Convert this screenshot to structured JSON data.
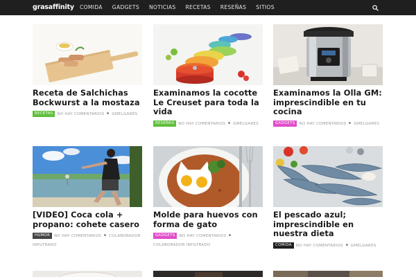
{
  "header": {
    "logo": "grasaffinity",
    "nav": [
      "COMIDA",
      "GADGETS",
      "NOTICIAS",
      "RECETAS",
      "RESEÑAS",
      "SITIOS"
    ]
  },
  "colors": {
    "topbar": "#1f1f1f",
    "recetas": "#5fbf3c",
    "resenas": "#5fbf3c",
    "gadgets": "#e14ecb",
    "humor": "#444444",
    "comida": "#1f1f1f"
  },
  "posts": [
    {
      "title": "Receta de Salchichas Bockwurst a la mostaza",
      "category": "RECETAS",
      "comments": "NO HAY COMENTARIOS",
      "author": "GMELGARES",
      "image": "sausages-mustard"
    },
    {
      "title": "Examinamos la cocotte Le Creuset para toda la vida",
      "category": "RESEÑAS",
      "comments": "NO HAY COMENTARIOS",
      "author": "GMELGARES",
      "image": "colorful-cocottes"
    },
    {
      "title": "Examinamos la Olla GM: imprescindible en tu cocina",
      "category": "GADGETS",
      "comments": "NO HAY COMENTARIOS",
      "author": "GMELGARES",
      "image": "pressure-cooker"
    },
    {
      "title": "[VIDEO] Coca cola + propano: cohete casero",
      "category": "HUMOR",
      "comments": "NO HAY COMENTARIOS",
      "author": "COLABORADOR INFILTRADO",
      "image": "lake-rocket"
    },
    {
      "title": "Molde para huevos con forma de gato",
      "category": "GADGETS",
      "comments": "NO HAY COMENTARIOS",
      "author": "COLABORADOR INFILTRADO",
      "image": "cat-eggs"
    },
    {
      "title": "El pescado azul; imprescindible en nuestra dieta",
      "category": "COMIDA",
      "comments": "NO HAY COMENTARIOS",
      "author": "GMELGARES",
      "image": "blue-fish"
    }
  ]
}
